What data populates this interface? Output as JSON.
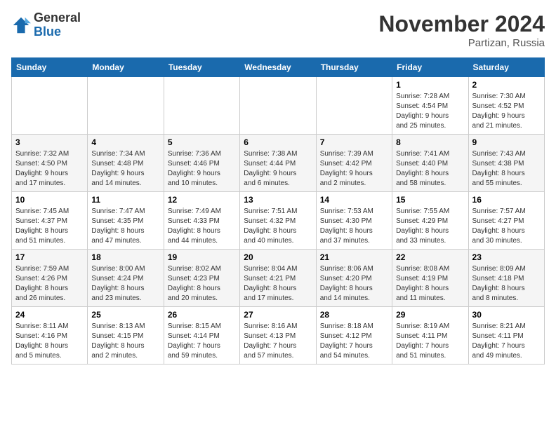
{
  "logo": {
    "general": "General",
    "blue": "Blue"
  },
  "title": "November 2024",
  "location": "Partizan, Russia",
  "days_of_week": [
    "Sunday",
    "Monday",
    "Tuesday",
    "Wednesday",
    "Thursday",
    "Friday",
    "Saturday"
  ],
  "weeks": [
    [
      {
        "day": "",
        "info": ""
      },
      {
        "day": "",
        "info": ""
      },
      {
        "day": "",
        "info": ""
      },
      {
        "day": "",
        "info": ""
      },
      {
        "day": "",
        "info": ""
      },
      {
        "day": "1",
        "info": "Sunrise: 7:28 AM\nSunset: 4:54 PM\nDaylight: 9 hours\nand 25 minutes."
      },
      {
        "day": "2",
        "info": "Sunrise: 7:30 AM\nSunset: 4:52 PM\nDaylight: 9 hours\nand 21 minutes."
      }
    ],
    [
      {
        "day": "3",
        "info": "Sunrise: 7:32 AM\nSunset: 4:50 PM\nDaylight: 9 hours\nand 17 minutes."
      },
      {
        "day": "4",
        "info": "Sunrise: 7:34 AM\nSunset: 4:48 PM\nDaylight: 9 hours\nand 14 minutes."
      },
      {
        "day": "5",
        "info": "Sunrise: 7:36 AM\nSunset: 4:46 PM\nDaylight: 9 hours\nand 10 minutes."
      },
      {
        "day": "6",
        "info": "Sunrise: 7:38 AM\nSunset: 4:44 PM\nDaylight: 9 hours\nand 6 minutes."
      },
      {
        "day": "7",
        "info": "Sunrise: 7:39 AM\nSunset: 4:42 PM\nDaylight: 9 hours\nand 2 minutes."
      },
      {
        "day": "8",
        "info": "Sunrise: 7:41 AM\nSunset: 4:40 PM\nDaylight: 8 hours\nand 58 minutes."
      },
      {
        "day": "9",
        "info": "Sunrise: 7:43 AM\nSunset: 4:38 PM\nDaylight: 8 hours\nand 55 minutes."
      }
    ],
    [
      {
        "day": "10",
        "info": "Sunrise: 7:45 AM\nSunset: 4:37 PM\nDaylight: 8 hours\nand 51 minutes."
      },
      {
        "day": "11",
        "info": "Sunrise: 7:47 AM\nSunset: 4:35 PM\nDaylight: 8 hours\nand 47 minutes."
      },
      {
        "day": "12",
        "info": "Sunrise: 7:49 AM\nSunset: 4:33 PM\nDaylight: 8 hours\nand 44 minutes."
      },
      {
        "day": "13",
        "info": "Sunrise: 7:51 AM\nSunset: 4:32 PM\nDaylight: 8 hours\nand 40 minutes."
      },
      {
        "day": "14",
        "info": "Sunrise: 7:53 AM\nSunset: 4:30 PM\nDaylight: 8 hours\nand 37 minutes."
      },
      {
        "day": "15",
        "info": "Sunrise: 7:55 AM\nSunset: 4:29 PM\nDaylight: 8 hours\nand 33 minutes."
      },
      {
        "day": "16",
        "info": "Sunrise: 7:57 AM\nSunset: 4:27 PM\nDaylight: 8 hours\nand 30 minutes."
      }
    ],
    [
      {
        "day": "17",
        "info": "Sunrise: 7:59 AM\nSunset: 4:26 PM\nDaylight: 8 hours\nand 26 minutes."
      },
      {
        "day": "18",
        "info": "Sunrise: 8:00 AM\nSunset: 4:24 PM\nDaylight: 8 hours\nand 23 minutes."
      },
      {
        "day": "19",
        "info": "Sunrise: 8:02 AM\nSunset: 4:23 PM\nDaylight: 8 hours\nand 20 minutes."
      },
      {
        "day": "20",
        "info": "Sunrise: 8:04 AM\nSunset: 4:21 PM\nDaylight: 8 hours\nand 17 minutes."
      },
      {
        "day": "21",
        "info": "Sunrise: 8:06 AM\nSunset: 4:20 PM\nDaylight: 8 hours\nand 14 minutes."
      },
      {
        "day": "22",
        "info": "Sunrise: 8:08 AM\nSunset: 4:19 PM\nDaylight: 8 hours\nand 11 minutes."
      },
      {
        "day": "23",
        "info": "Sunrise: 8:09 AM\nSunset: 4:18 PM\nDaylight: 8 hours\nand 8 minutes."
      }
    ],
    [
      {
        "day": "24",
        "info": "Sunrise: 8:11 AM\nSunset: 4:16 PM\nDaylight: 8 hours\nand 5 minutes."
      },
      {
        "day": "25",
        "info": "Sunrise: 8:13 AM\nSunset: 4:15 PM\nDaylight: 8 hours\nand 2 minutes."
      },
      {
        "day": "26",
        "info": "Sunrise: 8:15 AM\nSunset: 4:14 PM\nDaylight: 7 hours\nand 59 minutes."
      },
      {
        "day": "27",
        "info": "Sunrise: 8:16 AM\nSunset: 4:13 PM\nDaylight: 7 hours\nand 57 minutes."
      },
      {
        "day": "28",
        "info": "Sunrise: 8:18 AM\nSunset: 4:12 PM\nDaylight: 7 hours\nand 54 minutes."
      },
      {
        "day": "29",
        "info": "Sunrise: 8:19 AM\nSunset: 4:11 PM\nDaylight: 7 hours\nand 51 minutes."
      },
      {
        "day": "30",
        "info": "Sunrise: 8:21 AM\nSunset: 4:11 PM\nDaylight: 7 hours\nand 49 minutes."
      }
    ]
  ]
}
